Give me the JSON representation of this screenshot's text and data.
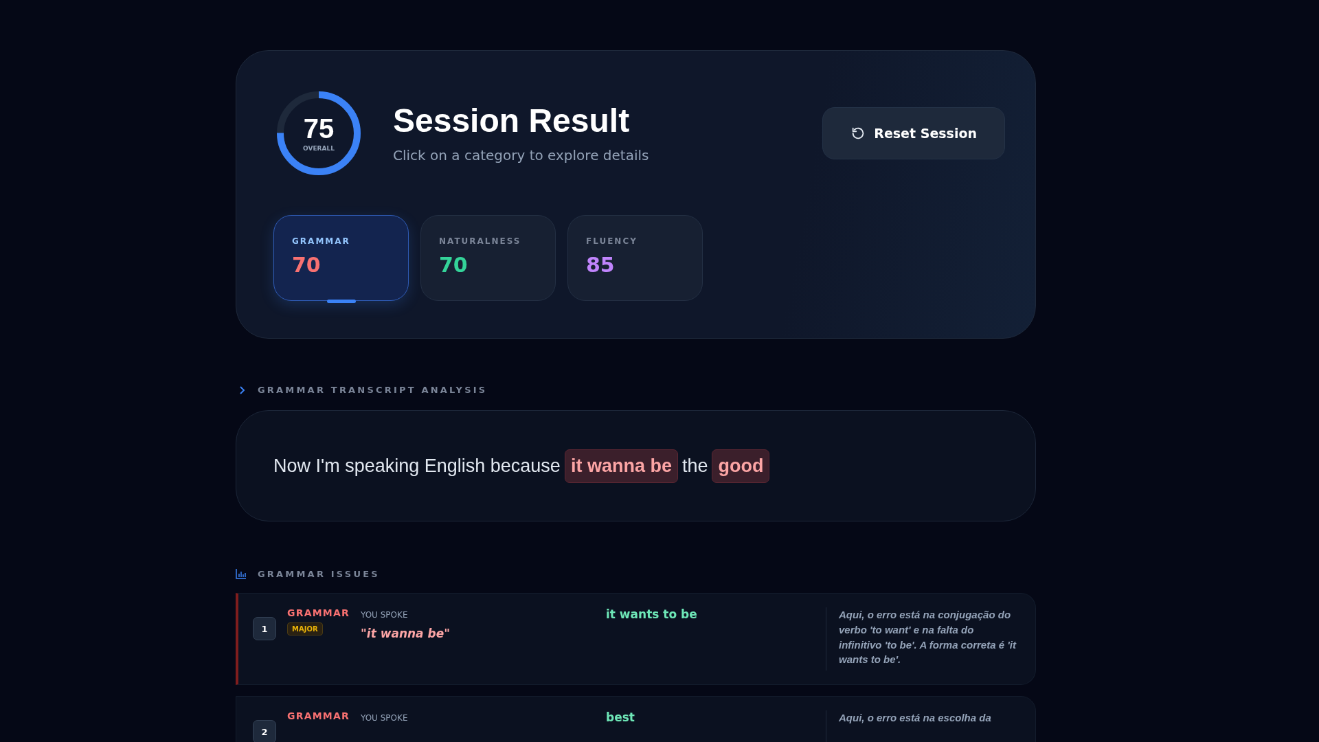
{
  "overall": {
    "score": "75",
    "label": "OVERALL",
    "level": 0.75
  },
  "title": "Session Result",
  "subtitle": "Click on a category to explore details",
  "reset_button": "Reset Session",
  "categories": [
    {
      "label": "GRAMMAR",
      "score": "70",
      "color": "#f87171",
      "selected": true
    },
    {
      "label": "NATURALNESS",
      "score": "70",
      "color": "#34d399",
      "selected": false
    },
    {
      "label": "FLUENCY",
      "score": "85",
      "color": "#c084fc",
      "selected": false
    }
  ],
  "transcript": {
    "heading": "GRAMMAR TRANSCRIPT ANALYSIS",
    "segments": [
      {
        "kind": "plain",
        "text": "Now I'm speaking English because"
      },
      {
        "kind": "error",
        "text": "it wanna be"
      },
      {
        "kind": "plain",
        "text": "the"
      },
      {
        "kind": "error",
        "text": "good"
      }
    ]
  },
  "issues": {
    "heading": "GRAMMAR ISSUES",
    "items": [
      {
        "number": "1",
        "category": "GRAMMAR",
        "severity": "MAJOR",
        "spoke_label": "YOU SPOKE",
        "spoken": "\"it wanna be\"",
        "correction": "it wants to be",
        "explanation": "Aqui, o erro está na conjugação do verbo 'to want' e na falta do infinitivo 'to be'. A forma correta é 'it wants to be'."
      },
      {
        "number": "2",
        "category": "GRAMMAR",
        "spoke_label": "YOU SPOKE",
        "correction": "best",
        "explanation": "Aqui, o erro está na escolha da"
      }
    ]
  }
}
